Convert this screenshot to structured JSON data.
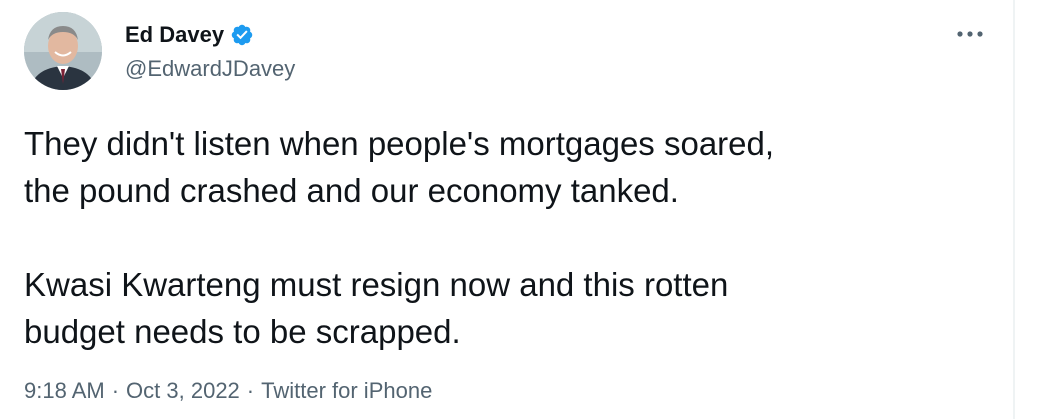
{
  "author": {
    "name": "Ed Davey",
    "handle": "@EdwardJDavey",
    "verified": true,
    "avatar_icon": "profile-photo"
  },
  "more_icon": "more-horizontal-icon",
  "tweet": {
    "paragraphs": [
      "They didn't listen when people's mortgages soared,\nthe pound crashed and our economy tanked.",
      "Kwasi Kwarteng must resign now and this rotten\nbudget needs to be scrapped."
    ]
  },
  "meta": {
    "time": "9:18 AM",
    "separator": "·",
    "date": "Oct 3, 2022",
    "source": "Twitter for iPhone"
  },
  "colors": {
    "text": "#0f1419",
    "secondary": "#536471",
    "verified": "#1d9bf0"
  }
}
